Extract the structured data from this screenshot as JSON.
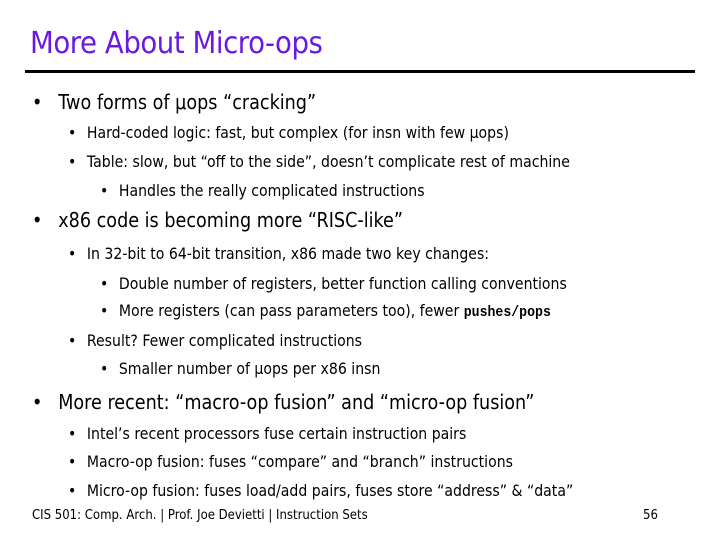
{
  "slide": {
    "title": "More About Micro-ops",
    "title_color": "#6a1ae0",
    "bullets": {
      "b1": "Two forms of μops “cracking”",
      "b1_1": "Hard-coded logic: fast, but complex (for insn with few μops)",
      "b1_2": "Table: slow, but “off to the side”, doesn’t complicate rest of machine",
      "b1_2_1": "Handles the really complicated instructions",
      "b2": "x86 code is becoming more “RISC-like”",
      "b2_1": "In 32-bit to 64-bit transition, x86 made two key changes:",
      "b2_1_1": "Double number of registers, better function calling conventions",
      "b2_1_2_prefix": "More registers (can pass parameters too), fewer ",
      "b2_1_2_code": "pushes/pops",
      "b2_2": "Result?  Fewer complicated instructions",
      "b2_2_1": "Smaller number of μops per x86 insn",
      "b3": "More recent: “macro-op fusion” and “micro-op fusion”",
      "b3_1": "Intel’s recent processors fuse certain instruction pairs",
      "b3_2": "Macro-op fusion: fuses “compare” and “branch” instructions",
      "b3_3": "Micro-op fusion: fuses load/add pairs, fuses store “address” & “data”"
    },
    "bullet_glyph": "•"
  },
  "footer": {
    "left": "CIS 501: Comp. Arch.  |  Prof. Joe Devietti  |  Instruction Sets",
    "page_number": "56"
  }
}
